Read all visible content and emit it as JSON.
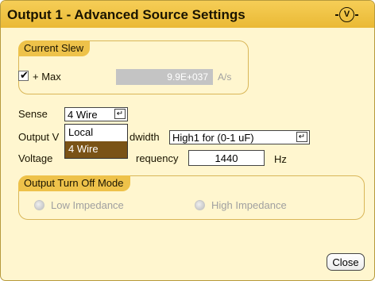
{
  "window": {
    "title": "Output 1 - Advanced Source Settings",
    "icon": "voltage-circle-icon",
    "icon_text": "V"
  },
  "current_slew": {
    "label": "Current Slew",
    "max_checkbox": {
      "label": "+ Max",
      "checked": true
    },
    "value": "9.9E+037",
    "unit": "A/s"
  },
  "sense": {
    "label": "Sense",
    "selected": "4 Wire",
    "options": [
      "Local",
      "4 Wire"
    ]
  },
  "output_voltage_bandwidth": {
    "label_left": "Output V",
    "label_right": "dwidth",
    "selected": "High1 for (0-1 uF)"
  },
  "voltage_bandwidth_frequency": {
    "label_left": "Voltage ",
    "label_right": "requency",
    "value": "1440",
    "unit": "Hz"
  },
  "output_turn_off_mode": {
    "label": "Output Turn Off Mode",
    "options": [
      "Low Impedance",
      "High Impedance"
    ]
  },
  "buttons": {
    "close": "Close"
  },
  "colors": {
    "titlebar": "#eab935",
    "background": "#fff6cf",
    "dropdown_selected": "#7a5316",
    "group_label": "#eec24a"
  }
}
